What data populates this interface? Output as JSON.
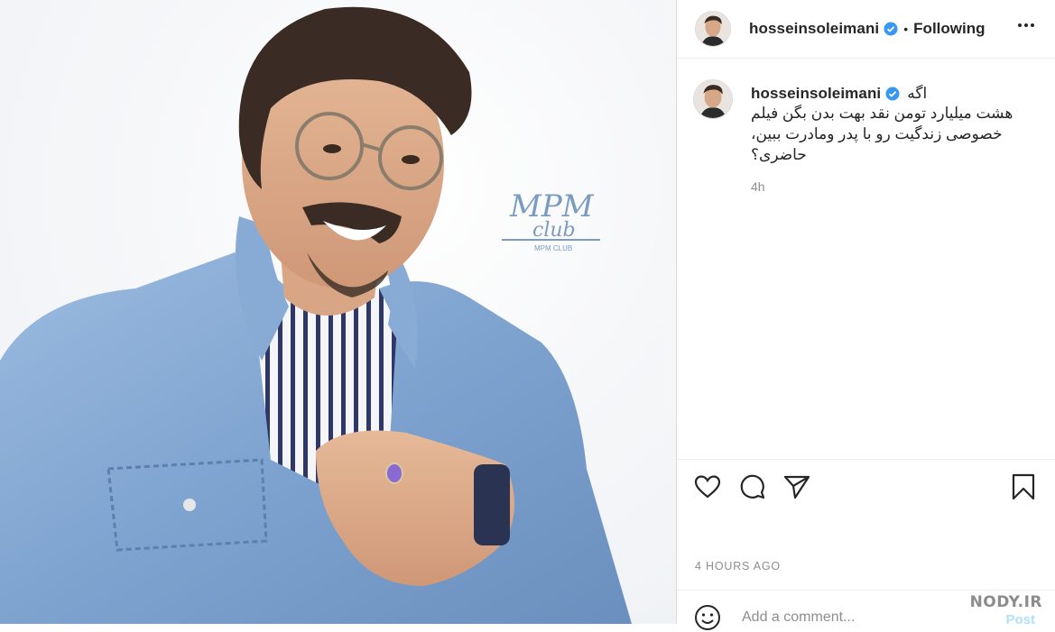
{
  "post": {
    "username": "hosseinsoleimani",
    "verified": true,
    "follow_status": "Following",
    "caption_first_word": "اگه",
    "caption_rest": "هشت میلیارد تومن نقد بهت بدن بگن فیلم خصوصی زندگیت رو با پدر ومادرت ببین، حاضری؟",
    "relative_time": "4h",
    "timestamp": "4 HOURS AGO"
  },
  "photo": {
    "watermark_line1": "MPM",
    "watermark_line2": "club",
    "watermark_small": "MPM CLUB"
  },
  "comment_box": {
    "placeholder": "Add a comment...",
    "post_label": "Post"
  },
  "site_watermark": {
    "text": "NODY.IR"
  },
  "icons": {
    "like": "heart-icon",
    "comment": "comment-bubble-icon",
    "share": "paper-plane-icon",
    "save": "bookmark-icon",
    "more": "more-options-icon",
    "emoji": "emoji-smile-icon",
    "verified": "verified-badge-icon"
  },
  "colors": {
    "verified_blue": "#3897f0",
    "post_button_disabled": "#b2dffc",
    "secondary_text": "#8e8e8e",
    "jacket_denim": "#7fa3cf"
  }
}
